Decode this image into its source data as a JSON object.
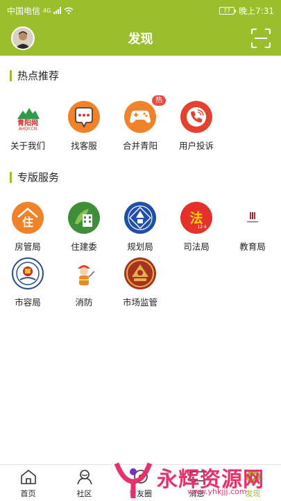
{
  "status_bar": {
    "carrier": "中国电信",
    "network": "4G",
    "battery": "77",
    "time": "晚上7:31"
  },
  "header": {
    "title": "发现"
  },
  "hot": {
    "heading": "热点推荐",
    "items": [
      {
        "label": "关于我们",
        "icon": "qingyang-logo-icon",
        "logo_main": "青阳网",
        "logo_sub": "AHQY.CN"
      },
      {
        "label": "找客服",
        "icon": "chat-bubble-icon"
      },
      {
        "label": "合并青阳",
        "icon": "gamepad-icon",
        "badge": "热"
      },
      {
        "label": "用户投诉",
        "icon": "phone-icon"
      }
    ]
  },
  "special": {
    "heading": "专版服务",
    "items": [
      {
        "label": "房管局",
        "icon": "housing-bureau-icon",
        "glyph": "住"
      },
      {
        "label": "住建委",
        "icon": "construction-committee-icon"
      },
      {
        "label": "规划局",
        "icon": "planning-bureau-icon"
      },
      {
        "label": "司法局",
        "icon": "justice-bureau-icon",
        "glyph": "法",
        "sub": "12·4"
      },
      {
        "label": "教育局",
        "icon": "education-bureau-icon"
      },
      {
        "label": "市容局",
        "icon": "city-appearance-icon"
      },
      {
        "label": "消防",
        "icon": "firefighter-icon"
      },
      {
        "label": "市场监管",
        "icon": "market-supervision-icon"
      }
    ]
  },
  "tabs": [
    {
      "label": "首页",
      "icon": "home-icon"
    },
    {
      "label": "社区",
      "icon": "community-icon"
    },
    {
      "label": "青友圈",
      "icon": "friends-circle-icon"
    },
    {
      "label": "消息",
      "icon": "message-icon"
    },
    {
      "label": "发现",
      "icon": "discover-icon"
    }
  ],
  "watermark": {
    "text": "永辉资源网",
    "url": "www.yhkjjj.com"
  },
  "colors": {
    "brand": "#9bbe2d",
    "orange": "#f0832a",
    "red": "#e4412f",
    "badge": "#ea4b3b"
  }
}
